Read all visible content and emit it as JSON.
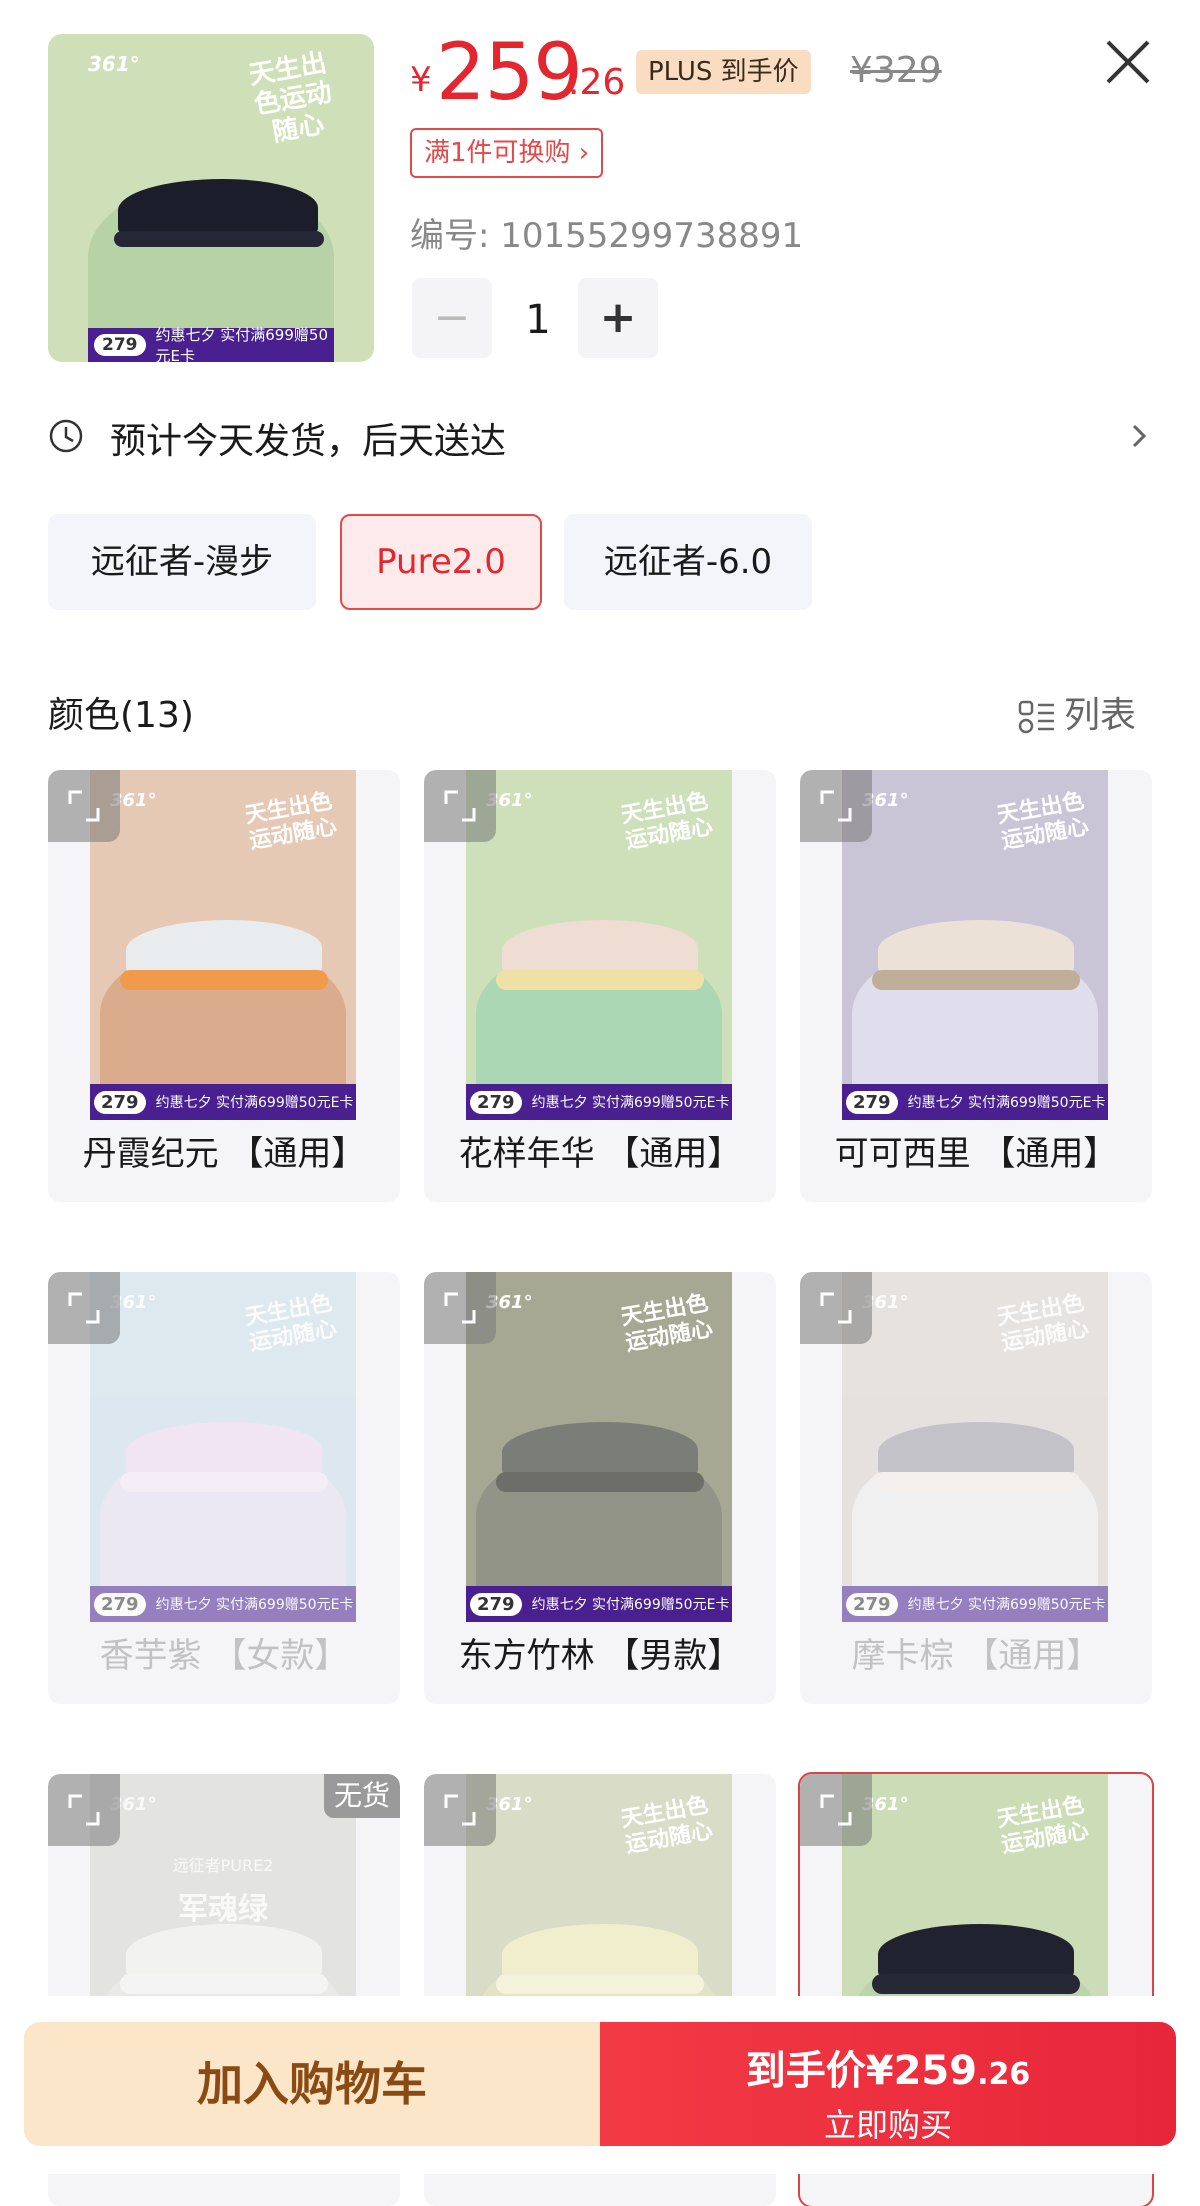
{
  "header": {
    "promo_price": "279",
    "promo_text": "约惠七夕 实付满699赠50元E卡",
    "thumb_brand": "361°",
    "thumb_slogan": "天生出色运动随心"
  },
  "price": {
    "currency": "¥",
    "main": "259",
    "decimal": ".26",
    "badge": "PLUS 到手价",
    "original": "¥329",
    "swap_tag": "满1件可换购 ›",
    "sku": "编号: 10155299738891"
  },
  "quantity": {
    "minus": "−",
    "value": "1",
    "plus": "+"
  },
  "delivery": {
    "text": "预计今天发货，后天送达"
  },
  "styles": [
    {
      "label": "远征者-漫步",
      "selected": false
    },
    {
      "label": "Pure2.0",
      "selected": true
    },
    {
      "label": "远征者-6.0",
      "selected": false
    }
  ],
  "colors": {
    "title": "颜色(13)",
    "list_label": "列表",
    "items": [
      {
        "label": "丹霞纪元 【通用】",
        "bg": "#e6c9b4",
        "hill": "#d8a888",
        "shoe": "#e8ecef",
        "sole": "#f19a4c",
        "state": "normal"
      },
      {
        "label": "花样年华 【通用】",
        "bg": "#cde0b9",
        "hill": "#a9d6b5",
        "shoe": "#efdcd2",
        "sole": "#efe0a6",
        "state": "normal"
      },
      {
        "label": "可可西里 【通用】",
        "bg": "#c9c4d6",
        "hill": "#e2e0ee",
        "shoe": "#ece1d6",
        "sole": "#bfae98",
        "state": "normal"
      },
      {
        "label": "香芋紫 【女款】",
        "bg": "#c9dde8",
        "hill": "#e5dcef",
        "shoe": "#efd9ef",
        "sole": "#f3e8f3",
        "state": "dim"
      },
      {
        "label": "东方竹林 【男款】",
        "bg": "#a6a894",
        "hill": "#8f9184",
        "shoe": "#7b7d78",
        "sole": "#6d6e68",
        "state": "normal"
      },
      {
        "label": "摩卡棕 【通用】",
        "bg": "#d7d2cc",
        "hill": "#eeeeee",
        "shoe": "#9b9aa1",
        "sole": "#f0ebe4",
        "state": "dim"
      },
      {
        "label": "",
        "bg": "#c9cbc1",
        "hill": "#d9dbd2",
        "shoe": "#eef0e6",
        "sole": "#f2f3ed",
        "state": "soldout",
        "caption_cn": "军魂绿",
        "caption_en": "远征者PURE2",
        "soldout": "无货"
      },
      {
        "label": "",
        "bg": "#d9dcc6",
        "hill": "#e3e3c8",
        "shoe": "#f0eecc",
        "sole": "#f4f2da",
        "state": "normal"
      },
      {
        "label": "",
        "bg": "#cbdcb6",
        "hill": "#b9d4a8",
        "shoe": "#20222f",
        "sole": "#262836",
        "state": "selected"
      }
    ]
  },
  "bottom": {
    "add_cart": "加入购物车",
    "buy_prefix": "到手价¥259",
    "buy_decimal": ".26",
    "buy_label": "立即购买"
  },
  "colors_theme": {
    "accent": "#e4262f",
    "promo_purple": "#4a1f8f",
    "cart_bg": "#fbe6c9"
  }
}
